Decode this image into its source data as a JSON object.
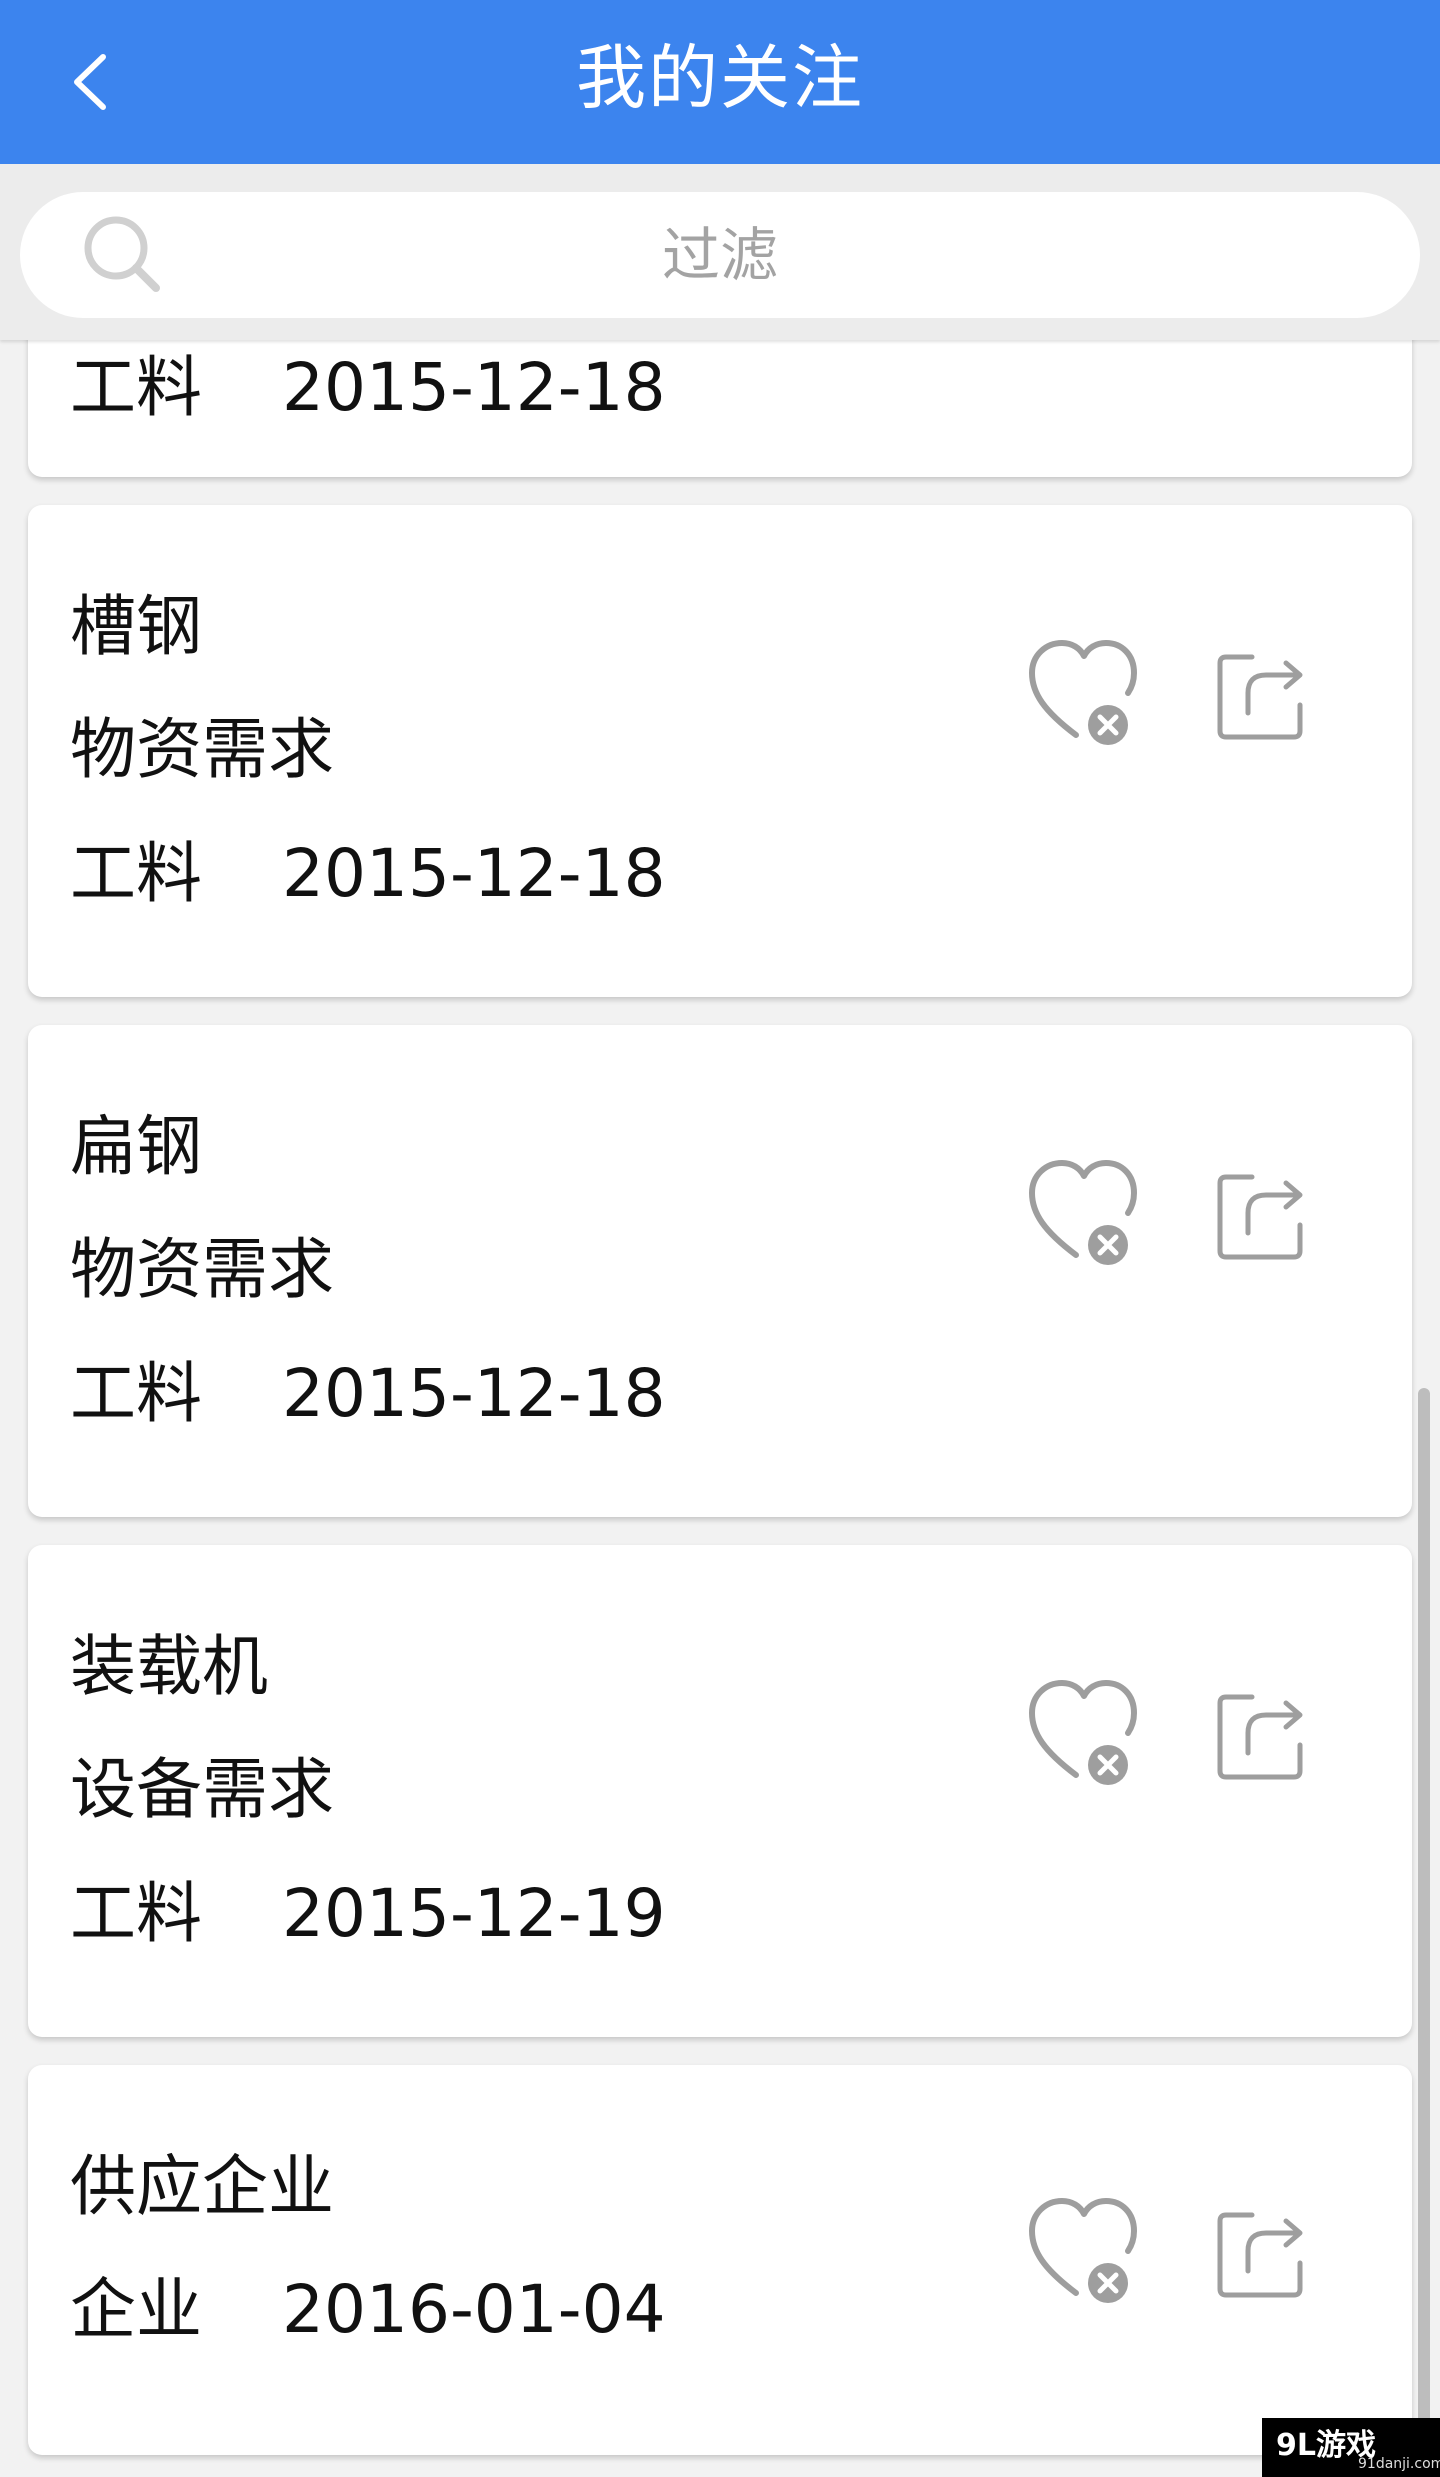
{
  "app_bar": {
    "title": "我的关注",
    "back_icon": "chevron-left-icon"
  },
  "search": {
    "placeholder": "过滤",
    "icon": "search-icon"
  },
  "list": [
    {
      "title": "",
      "type": "",
      "category": "工料",
      "date": "2015-12-18",
      "partially_hidden": true
    },
    {
      "title": "槽钢",
      "type": "物资需求",
      "category": "工料",
      "date": "2015-12-18"
    },
    {
      "title": "扁钢",
      "type": "物资需求",
      "category": "工料",
      "date": "2015-12-18"
    },
    {
      "title": "装载机",
      "type": "设备需求",
      "category": "工料",
      "date": "2015-12-19"
    },
    {
      "title": "供应企业",
      "category": "企业",
      "date": "2016-01-04"
    }
  ],
  "item_actions": {
    "unfollow_icon": "heart-remove-icon",
    "share_icon": "share-icon"
  },
  "watermark": {
    "logo": "9L游戏",
    "url": "91danji.com"
  },
  "colors": {
    "app_bar": "#3c84ee",
    "background": "#f2f2f2",
    "card": "#ffffff",
    "icon_gray": "#9e9e9e"
  }
}
